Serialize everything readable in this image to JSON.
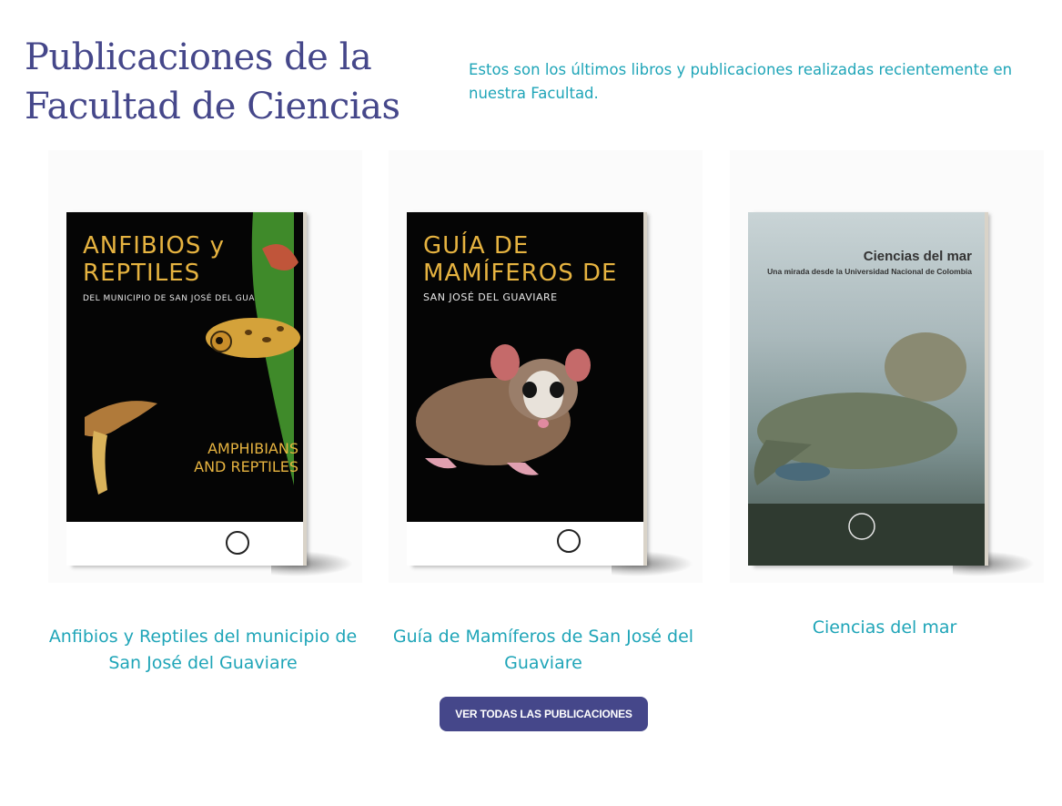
{
  "section": {
    "title": "Publicaciones de la Facultad de Ciencias",
    "intro": "Estos son los últimos libros y publicaciones realizadas recientemente en nuestra Facultad."
  },
  "publications": [
    {
      "caption": "Anfibios y Reptiles del municipio de San José del Guaviare",
      "cover_title": "ANFIBIOS y REPTILES",
      "cover_subtitle": "DEL MUNICIPIO DE SAN JOSÉ DEL GUAVIARE"
    },
    {
      "caption": "Guía de Mamíferos de San José del Guaviare",
      "cover_title": "GUÍA DE MAMÍFEROS DE",
      "cover_subtitle": "SAN JOSÉ DEL GUAVIARE"
    },
    {
      "caption": "Ciencias del mar",
      "cover_title": "Ciencias del mar",
      "cover_subtitle": "Una mirada desde la Universidad Nacional de Colombia"
    }
  ],
  "cta": {
    "label": "VER TODAS LAS PUBLICACIONES"
  },
  "colors": {
    "heading": "#45478a",
    "accent": "#1fa5b8",
    "button": "#45478a"
  }
}
